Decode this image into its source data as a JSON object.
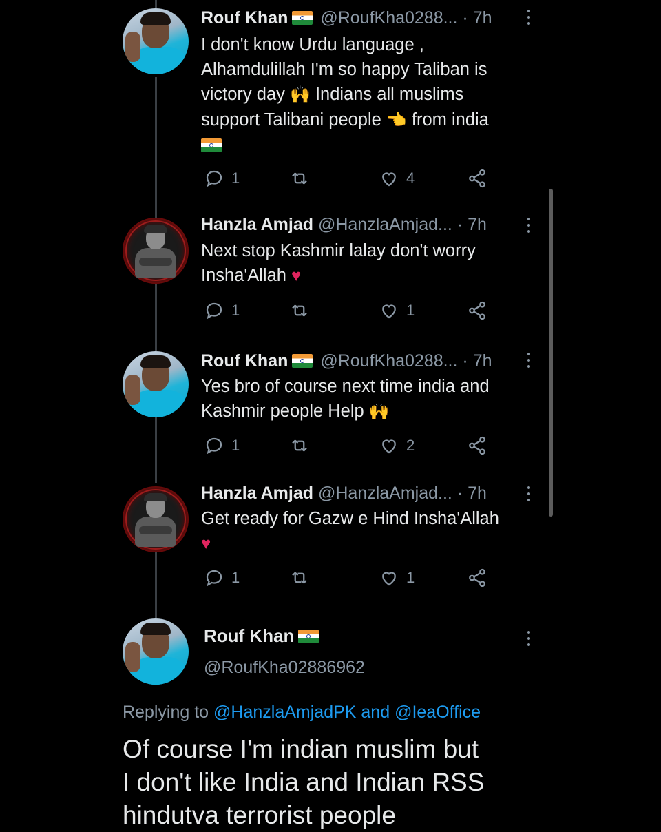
{
  "tweets": [
    {
      "name": "Rouf Khan",
      "handle": "@RoufKha0288...",
      "dot": "·",
      "time": "7h",
      "lines": [
        "I don't know Urdu language ,",
        "Alhamdulillah I'm so happy Taliban is",
        "victory day",
        "Indians all muslims",
        "support Talibani people",
        "from india"
      ],
      "replies": "1",
      "likes": "4"
    },
    {
      "name": "Hanzla Amjad",
      "handle": "@HanzlaAmjad...",
      "dot": "·",
      "time": "7h",
      "lines": [
        "Next stop Kashmir lalay don't worry",
        "Insha'Allah"
      ],
      "replies": "1",
      "likes": "1"
    },
    {
      "name": "Rouf Khan",
      "handle": "@RoufKha0288...",
      "dot": "·",
      "time": "7h",
      "lines": [
        "Yes bro of course next time india and",
        "Kashmir people Help"
      ],
      "replies": "1",
      "likes": "2"
    },
    {
      "name": "Hanzla Amjad",
      "handle": "@HanzlaAmjad...",
      "dot": "·",
      "time": "7h",
      "lines": [
        "Get ready for Gazw e Hind Insha'Allah"
      ],
      "replies": "1",
      "likes": "1"
    }
  ],
  "main": {
    "name": "Rouf Khan",
    "handle": "@RoufKha02886962",
    "replying_prefix": "Replying to",
    "replying_user1": "@HanzlaAmjadPK",
    "replying_and": "and",
    "replying_user2": "@IeaOffice",
    "text_lines": [
      "Of course I'm indian muslim but",
      "I don't like India and Indian RSS",
      "hindutva terrorist people"
    ]
  },
  "icons": {
    "reply": "reply-icon",
    "retweet": "retweet-icon",
    "like": "heart-outline-icon",
    "share": "share-icon",
    "more": "more-vertical-icon",
    "flag": "india-flag-emoji",
    "hands": "raised-hands-emoji",
    "pointing": "pointing-hand-emoji",
    "red_heart": "red-heart-emoji"
  },
  "colors": {
    "background": "#000000",
    "text": "#e7e9ea",
    "secondary": "#8b98a5",
    "link": "#1d9bf0"
  }
}
